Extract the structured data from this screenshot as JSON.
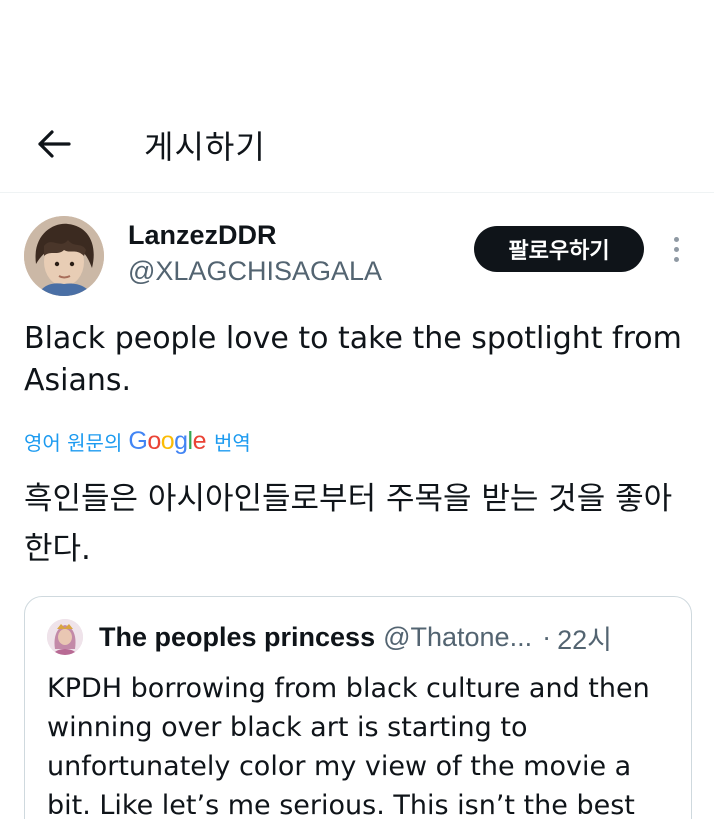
{
  "header": {
    "title": "게시하기",
    "back_icon": "arrow-left-icon"
  },
  "author": {
    "display_name": "LanzezDDR",
    "handle": "@XLAGCHISAGALA",
    "follow_label": "팔로우하기",
    "more_icon": "more-vertical-icon"
  },
  "tweet": {
    "text": "Black people love to take the spotlight from Asians.",
    "translate_prefix": "영어 원문의",
    "translate_brand": "Google",
    "translate_suffix": "번역",
    "translated_text": "흑인들은 아시아인들로부터 주목을 받는 것을 좋아한다."
  },
  "quote": {
    "name": "The peoples princess",
    "handle": "@Thatone...",
    "separator": "·",
    "time": "22시",
    "text": "KPDH borrowing from black culture and then winning over black art is starting to unfortunately color my view of the movie a bit. Like let’s me serious. This isn’t the best"
  },
  "colors": {
    "text": "#0f1419",
    "secondary": "#536471",
    "link": "#1d9bf0",
    "follow_bg": "#0f1419",
    "border": "#cfd9de"
  }
}
